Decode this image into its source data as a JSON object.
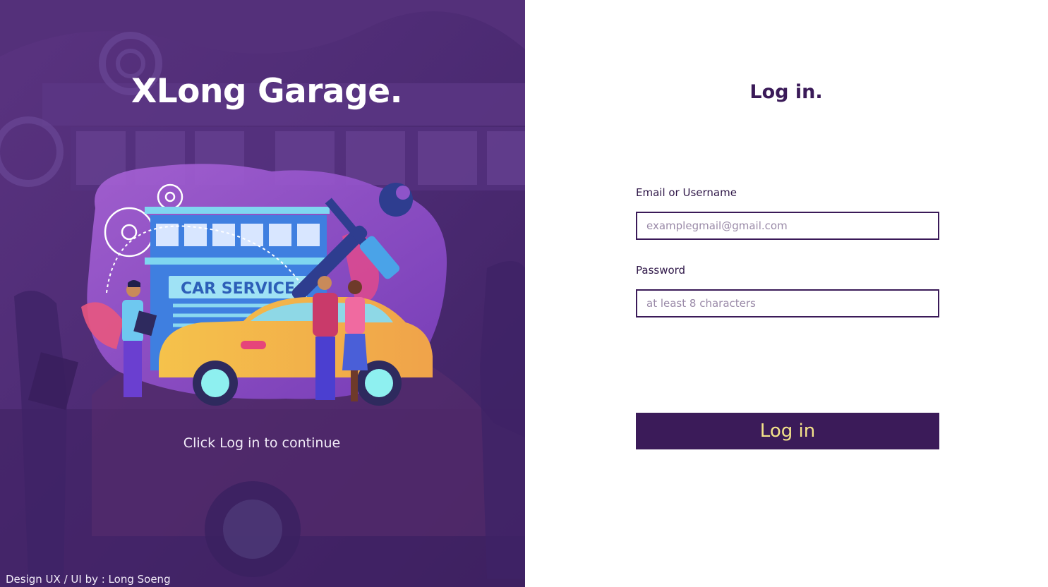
{
  "brand": {
    "title": "XLong Garage."
  },
  "illustration": {
    "sign_text": "CAR SERVICE"
  },
  "hero": {
    "hint": "Click Log in to continue"
  },
  "footer": {
    "credit": "Design UX / UI by : Long Soeng"
  },
  "login": {
    "title": "Log in.",
    "email_label": "Email or Username",
    "email_placeholder": "examplegmail@gmail.com",
    "password_label": "Password",
    "password_placeholder": "at least 8 characters",
    "submit_label": "Log in"
  },
  "colors": {
    "left_panel": "#4a2a6e",
    "accent_dark": "#3b1b59",
    "button_text": "#f4e38a",
    "background_right": "#ffffff"
  },
  "icons": [
    "gear-icon",
    "wrench-icon",
    "screwdriver-icon"
  ]
}
